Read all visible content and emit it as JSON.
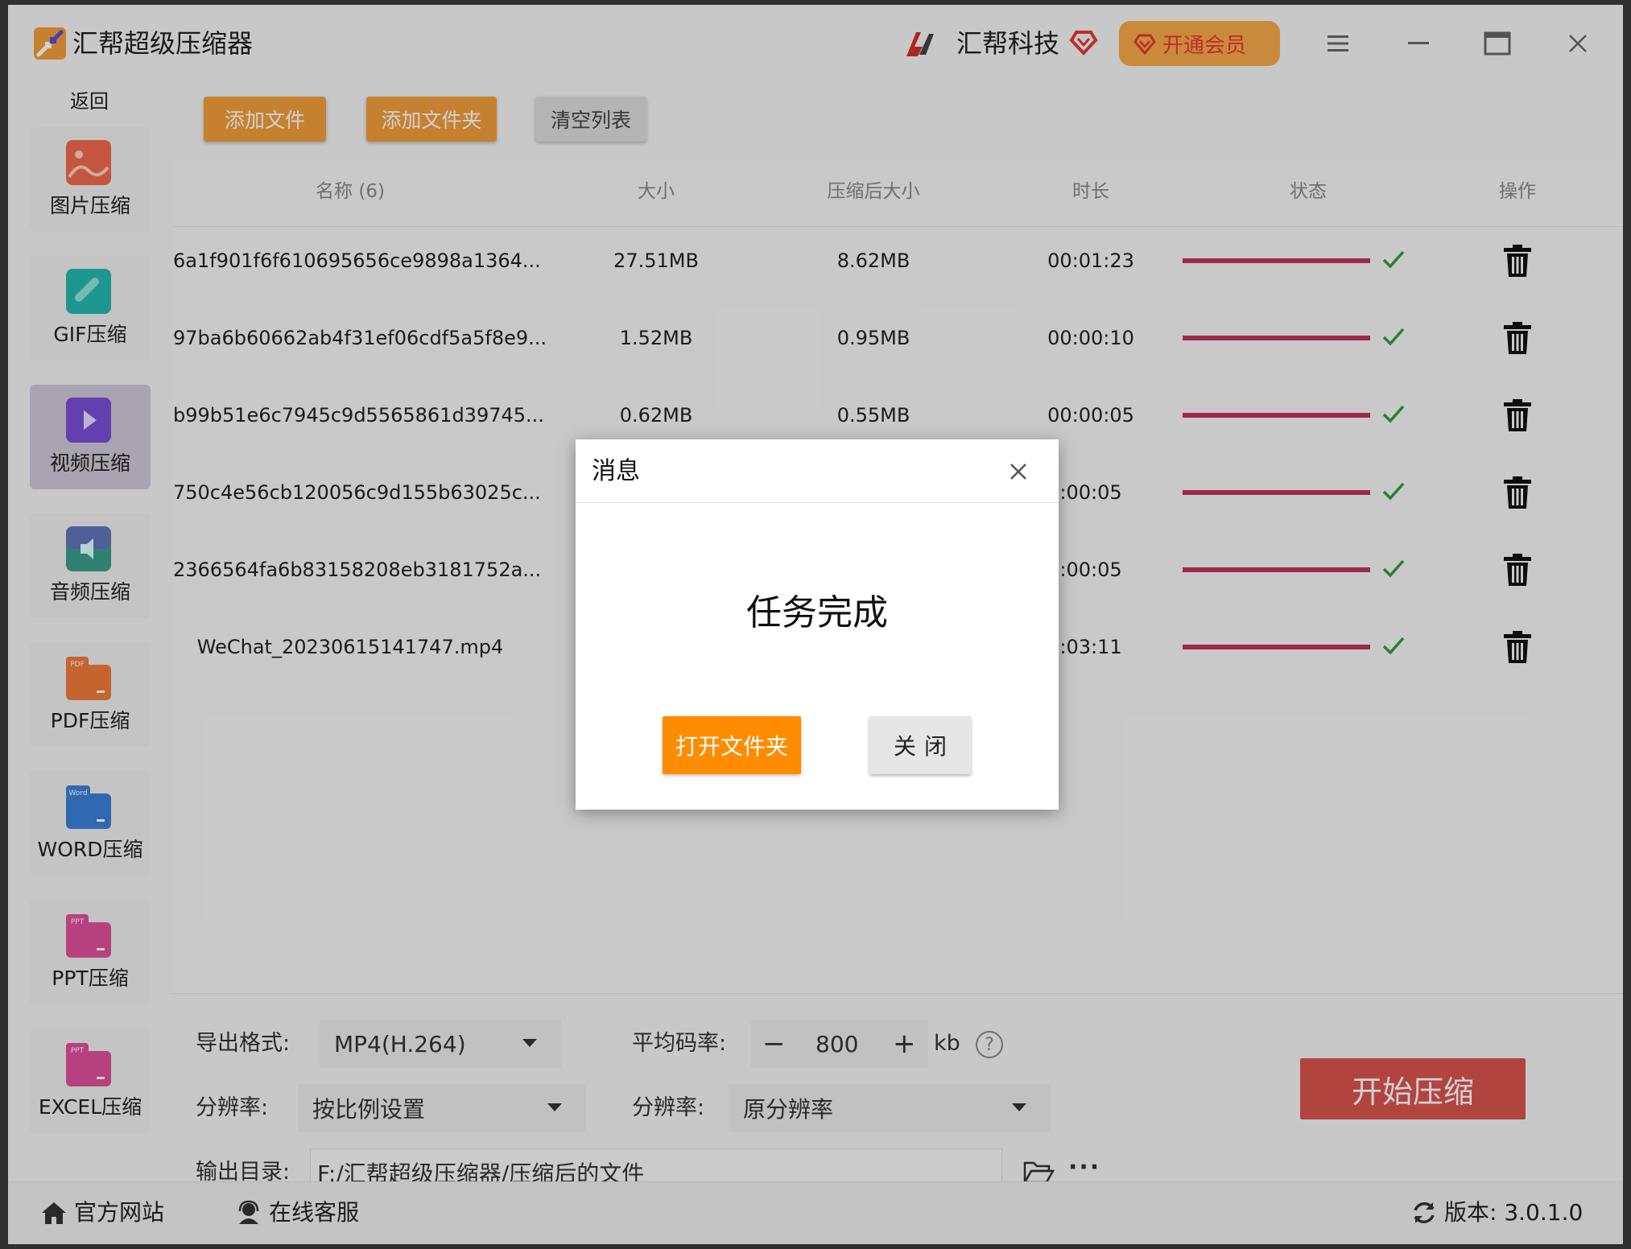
{
  "titlebar": {
    "app_title": "汇帮超级压缩器",
    "brand_name": "汇帮科技",
    "vip_label": "开通会员"
  },
  "sidebar": {
    "back_label": "返回",
    "items": [
      {
        "label": "图片压缩",
        "icon": "image-icon"
      },
      {
        "label": "GIF压缩",
        "icon": "gif-icon"
      },
      {
        "label": "视频压缩",
        "icon": "video-icon",
        "active": true
      },
      {
        "label": "音频压缩",
        "icon": "audio-icon"
      },
      {
        "label": "PDF压缩",
        "icon": "pdf-icon",
        "badge": "PDF"
      },
      {
        "label": "WORD压缩",
        "icon": "word-icon",
        "badge": "Word"
      },
      {
        "label": "PPT压缩",
        "icon": "ppt-icon",
        "badge": "PPT"
      },
      {
        "label": "EXCEL压缩",
        "icon": "excel-icon",
        "badge": "PPT"
      }
    ]
  },
  "toolbar": {
    "add_file": "添加文件",
    "add_folder": "添加文件夹",
    "clear_list": "清空列表"
  },
  "table": {
    "headers": {
      "name": "名称 (6)",
      "size": "大小",
      "compressed_size": "压缩后大小",
      "duration": "时长",
      "status": "状态",
      "action": "操作"
    },
    "rows": [
      {
        "name": "6a1f901f6f610695656ce9898a1364...",
        "size": "27.51MB",
        "compressed": "8.62MB",
        "duration": "00:01:23",
        "progress": 1.0
      },
      {
        "name": "97ba6b60662ab4f31ef06cdf5a5f8e9...",
        "size": "1.52MB",
        "compressed": "0.95MB",
        "duration": "00:00:10",
        "progress": 1.0
      },
      {
        "name": "b99b51e6c7945c9d5565861d39745...",
        "size": "0.62MB",
        "compressed": "0.55MB",
        "duration": "00:00:05",
        "progress": 1.0
      },
      {
        "name": "750c4e56cb120056c9d155b63025c...",
        "size": "",
        "compressed": "",
        "duration": ":00:05",
        "progress": 1.0
      },
      {
        "name": "2366564fa6b83158208eb3181752a...",
        "size": "",
        "compressed": "",
        "duration": ":00:05",
        "progress": 1.0
      },
      {
        "name": "WeChat_20230615141747.mp4",
        "size": "",
        "compressed": "",
        "duration": ":03:11",
        "progress": 1.0
      }
    ]
  },
  "settings": {
    "format_label": "导出格式:",
    "format_value": "MP4(H.264)",
    "bitrate_label": "平均码率:",
    "bitrate_minus": "−",
    "bitrate_value": "800",
    "bitrate_plus": "+",
    "bitrate_unit": "kb",
    "help": "?",
    "resolution_label_1": "分辨率:",
    "resolution_value_1": "按比例设置",
    "resolution_label_2": "分辨率:",
    "resolution_value_2": "原分辨率",
    "output_label": "输出目录:",
    "output_value": "F:/汇帮超级压缩器/压缩后的文件",
    "more": "···",
    "start_label": "开始压缩"
  },
  "statusbar": {
    "website": "官方网站",
    "support": "在线客服",
    "version": "版本: 3.0.1.0"
  },
  "dialog": {
    "title": "消息",
    "message": "任务完成",
    "open_folder": "打开文件夹",
    "close": "关闭"
  },
  "colors": {
    "accent_orange": "#f29e3b",
    "progress": "#c0325a",
    "check": "#2e9e3e",
    "start": "#d9534f"
  }
}
